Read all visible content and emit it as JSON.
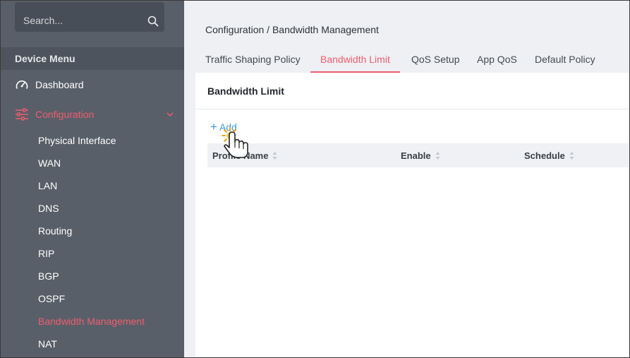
{
  "search": {
    "placeholder": "Search..."
  },
  "sidebar": {
    "menu_title": "Device Menu",
    "dashboard": "Dashboard",
    "configuration": "Configuration",
    "sub_items": [
      "Physical Interface",
      "WAN",
      "LAN",
      "DNS",
      "Routing",
      "RIP",
      "BGP",
      "OSPF",
      "Bandwidth Management",
      "NAT"
    ],
    "active_sub": "Bandwidth Management"
  },
  "breadcrumb": "Configuration / Bandwidth Management",
  "tabs": [
    {
      "label": "Traffic Shaping Policy"
    },
    {
      "label": "Bandwidth Limit"
    },
    {
      "label": "QoS Setup"
    },
    {
      "label": "App QoS"
    },
    {
      "label": "Default Policy"
    }
  ],
  "active_tab": "Bandwidth Limit",
  "panel": {
    "title": "Bandwidth Limit",
    "add_label": "Add",
    "columns": [
      "Profile Name",
      "Enable",
      "Schedule"
    ]
  },
  "colors": {
    "accent": "#ef5d6e",
    "link": "#3b98e0",
    "sidebar_bg": "#585f69"
  }
}
